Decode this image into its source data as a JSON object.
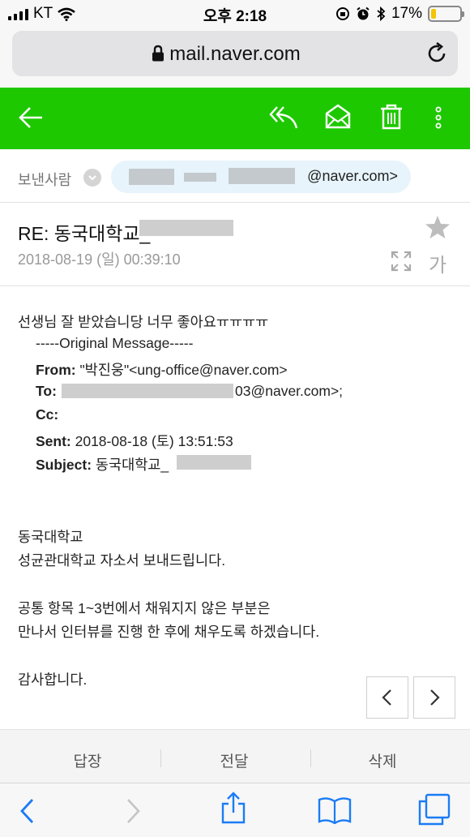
{
  "status_bar": {
    "carrier": "KT",
    "time": "오후 2:18",
    "battery_percent": "17%",
    "battery_level": 0.17,
    "battery_color": "#f5c400"
  },
  "browser": {
    "url": "mail.naver.com",
    "icons": [
      "lock-icon",
      "reload-icon"
    ]
  },
  "mail_toolbar": {
    "background": "#1ec800",
    "icons": [
      "back-arrow-icon",
      "reply-icon",
      "mark-unread-icon",
      "trash-icon",
      "more-vertical-icon"
    ]
  },
  "sender": {
    "label": "보낸사람",
    "email_suffix": "@naver.com>"
  },
  "message": {
    "subject": "RE: 동국대학교_",
    "date": "2018-08-19 (일) 00:39:10",
    "font_size_label": "가",
    "body_first_line": "선생님 잘 받았습니당 너무 좋아요ㅠㅠㅠㅠ",
    "original_header": "-----Original Message-----",
    "from_label": "From:",
    "from_value": " \"박진웅\"<ung-office@naver.com>",
    "to_label": "To:",
    "to_value_suffix": "03@naver.com>;",
    "cc_label": "Cc:",
    "sent_label": "Sent:",
    "sent_value": " 2018-08-18 (토) 13:51:53",
    "subject_label": "Subject:",
    "subject_value": " 동국대학교_",
    "paragraph1_line1": "동국대학교",
    "paragraph1_line2": "성균관대학교 자소서 보내드립니다.",
    "paragraph2_line1": "공통 항목 1~3번에서 채워지지 않은 부분은",
    "paragraph2_line2": "만나서 인터뷰를 진행 한 후에 채우도록 하겠습니다.",
    "closing": "감사합니다."
  },
  "actions": {
    "reply": "답장",
    "forward": "전달",
    "delete": "삭제"
  },
  "safari_toolbar": {
    "icons": [
      "back-icon",
      "forward-icon",
      "share-icon",
      "bookmarks-icon",
      "tabs-icon"
    ],
    "accent": "#1a7cf5"
  }
}
